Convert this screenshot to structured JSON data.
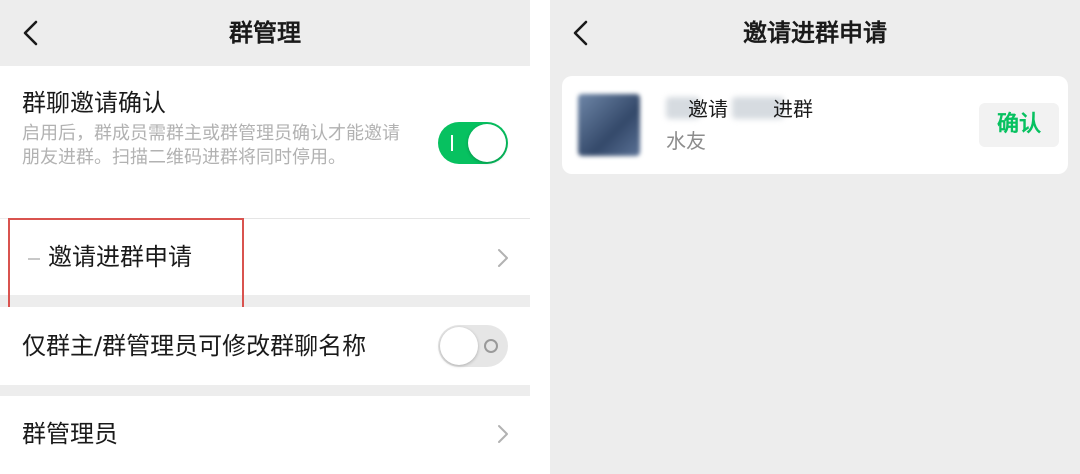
{
  "left_screen": {
    "title": "群管理",
    "invite_confirm": {
      "title": "群聊邀请确认",
      "description": "启用后，群成员需群主或群管理员确认才能邀请朋友进群。扫描二维码进群将同时停用。",
      "enabled": true
    },
    "invite_requests": {
      "label": "邀请进群申请"
    },
    "rename_restrict": {
      "label": "仅群主/群管理员可修改群聊名称",
      "enabled": false
    },
    "admins": {
      "label": "群管理员"
    }
  },
  "right_screen": {
    "title": "邀请进群申请",
    "request": {
      "action_word": "邀请",
      "suffix_word": "进群",
      "relation": "水友",
      "confirm_label": "确认"
    }
  },
  "colors": {
    "accent_green": "#07c160",
    "highlight_red": "#d9534f",
    "background_gray": "#ededed"
  },
  "icons": {
    "back": "chevron-left-icon",
    "row_arrow": "chevron-right-icon"
  }
}
